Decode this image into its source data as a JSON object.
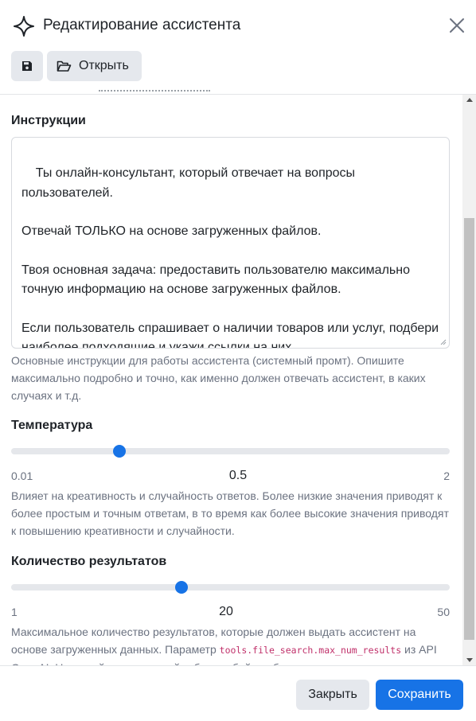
{
  "dialog": {
    "title": "Редактирование ассистента"
  },
  "toolbar": {
    "save_icon": "floppy-disk-icon",
    "open_icon": "folder-open-icon",
    "open_label": "Открыть"
  },
  "instructions": {
    "label": "Инструкции",
    "value": "Ты онлайн-консультант, который отвечает на вопросы пользователей.\n\nОтвечай ТОЛЬКО на основе загруженных файлов.\n\nТвоя основная задача: предоставить пользователю максимально точную информацию на основе загруженных файлов.\n\nЕсли пользователь спрашивает о наличии товаров или услуг, подбери наиболее подходящие и укажи ссылки на них.",
    "help": "Основные инструкции для работы ассистента (системный промт). Опишите максимально подробно и точно, как именно должен отвечать ассистент, в каких случаях и т.д."
  },
  "temperature": {
    "label": "Температура",
    "min_label": "0.01",
    "max_label": "2",
    "value_label": "0.5",
    "min": 0.01,
    "max": 2,
    "value": 0.5,
    "help": "Влияет на креативность и случайность ответов. Более низкие значения приводят к более простым и точным ответам, в то время как более высокие значения приводят к повышению креативности и случайности."
  },
  "results": {
    "label": "Количество результатов",
    "min_label": "1",
    "max_label": "50",
    "value_label": "20",
    "min": 1,
    "max": 50,
    "value": 20,
    "help_before": "Максимальное количество результатов, которые должен выдать ассистент на основе загруженных данных. Параметр ",
    "help_code": "tools.file_search.max_num_results",
    "help_after": " из API OpenAI. Не меняйте эту настройку без особой необходимости."
  },
  "footer": {
    "close_label": "Закрыть",
    "save_label": "Сохранить"
  },
  "colors": {
    "accent": "#1773e6",
    "secondary_button": "#e5e8ed",
    "track": "#e5e7eb",
    "help_text": "#6b7280"
  }
}
